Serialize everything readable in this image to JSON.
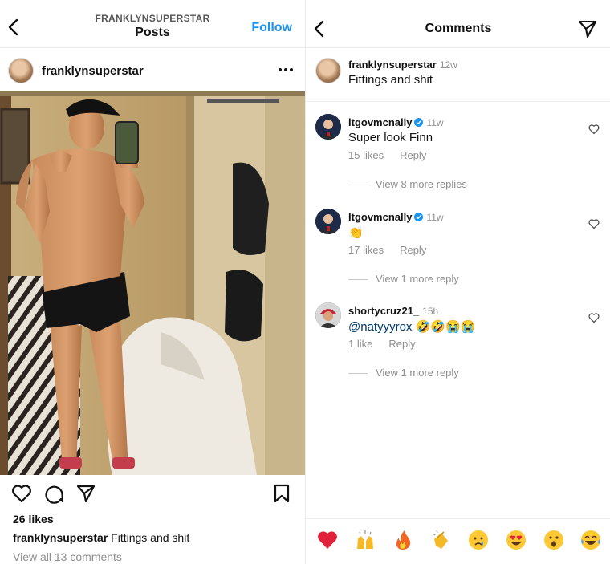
{
  "left": {
    "account_label": "FRANKLYNSUPERSTAR",
    "title": "Posts",
    "follow_label": "Follow",
    "post_username": "franklynsuperstar",
    "likes": "26 likes",
    "caption_user": "franklynsuperstar",
    "caption_text": "Fittings and shit",
    "view_all": "View all 13 comments",
    "icons": [
      "back-arrow-icon",
      "more-options-icon",
      "heart-icon",
      "comment-icon",
      "share-icon",
      "bookmark-icon"
    ]
  },
  "right": {
    "title": "Comments",
    "caption": {
      "user": "franklynsuperstar",
      "time": "12w",
      "text": "Fittings and shit"
    },
    "comments": [
      {
        "user": "ltgovmcnally",
        "time": "11w",
        "text": "Super look Finn",
        "likes": "15 likes",
        "reply": "Reply",
        "view_replies": "View 8 more replies"
      },
      {
        "user": "ltgovmcnally",
        "time": "11w",
        "text": "👏",
        "likes": "17 likes",
        "reply": "Reply",
        "view_replies": "View 1 more reply"
      },
      {
        "user": "shortycruz21_",
        "time": "15h",
        "mention": "@natyyyrox",
        "text": "🤣🤣😭😭",
        "likes": "1 like",
        "reply": "Reply",
        "view_replies": "View 1 more reply"
      }
    ],
    "emoji_bar": [
      "❤️",
      "🙌",
      "🔥",
      "👏",
      "😢",
      "😍",
      "😮",
      "😂"
    ],
    "icons": [
      "back-arrow-icon",
      "send-icon",
      "verified-badge-icon",
      "heart-outline-icon"
    ]
  },
  "colors": {
    "follow": "#1a96f0",
    "muted": "#8e8e8e",
    "verified": "#1a96f0",
    "mention": "#00376b"
  }
}
